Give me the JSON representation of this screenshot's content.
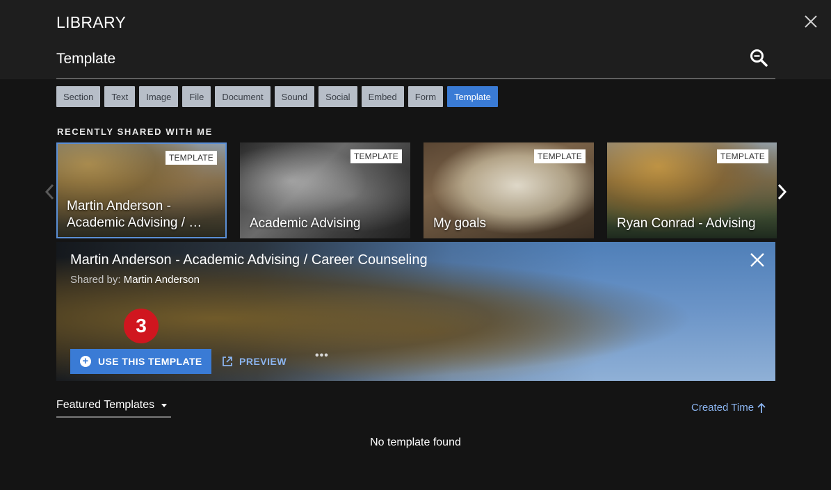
{
  "header": {
    "title": "LIBRARY"
  },
  "search": {
    "value": "Template",
    "placeholder": ""
  },
  "filters": [
    {
      "label": "Section",
      "active": false
    },
    {
      "label": "Text",
      "active": false
    },
    {
      "label": "Image",
      "active": false
    },
    {
      "label": "File",
      "active": false
    },
    {
      "label": "Document",
      "active": false
    },
    {
      "label": "Sound",
      "active": false
    },
    {
      "label": "Social",
      "active": false
    },
    {
      "label": "Embed",
      "active": false
    },
    {
      "label": "Form",
      "active": false
    },
    {
      "label": "Template",
      "active": true
    }
  ],
  "recent": {
    "heading": "RECENTLY SHARED WITH ME",
    "cards": [
      {
        "badge": "TEMPLATE",
        "title": "Martin Anderson - Academic Advising / …",
        "selected": true
      },
      {
        "badge": "TEMPLATE",
        "title": "Academic Advising",
        "selected": false
      },
      {
        "badge": "TEMPLATE",
        "title": "My goals",
        "selected": false
      },
      {
        "badge": "TEMPLATE",
        "title": "Ryan Conrad - Advising",
        "selected": false
      }
    ]
  },
  "detail": {
    "title": "Martin Anderson - Academic Advising / Career Counseling",
    "shared_by_label": "Shared by:",
    "shared_by_name": "Martin Anderson",
    "step_number": "3",
    "use_button": "USE THIS TEMPLATE",
    "preview_button": "PREVIEW",
    "more_label": "•••"
  },
  "list": {
    "sort_select": "Featured Templates",
    "order_label": "Created Time",
    "empty_message": "No template found"
  },
  "colors": {
    "accent": "#3a7bd5",
    "link": "#8bb4ef",
    "step_marker": "#d0161f",
    "chip": "#b7bec8"
  },
  "icons": {
    "close": "close-icon",
    "search": "search-icon",
    "chevron_left": "chevron-left-icon",
    "chevron_right": "chevron-right-icon",
    "add": "add-circle-icon",
    "open_external": "open-external-icon",
    "more": "more-icon",
    "sort_arrow": "arrow-up-icon"
  }
}
